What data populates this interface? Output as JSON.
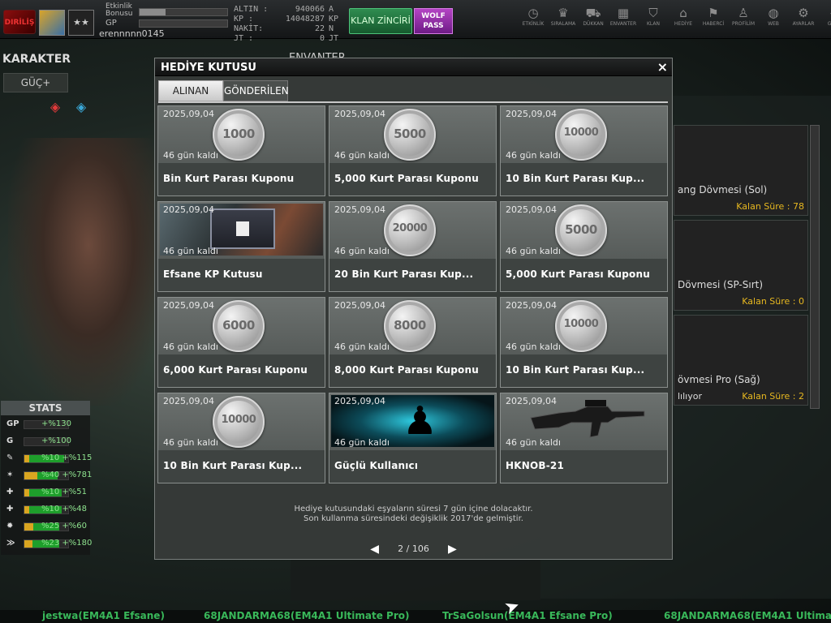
{
  "topbar": {
    "rank_badge": "DIRİLİŞ",
    "stars": "★★",
    "etkinlik_label": "Etkinlik Bonusu",
    "gp_label": "GP",
    "username": "erennnnn0145",
    "currency": [
      {
        "label": "ALTIN :",
        "value": "940066",
        "unit": "A"
      },
      {
        "label": "KP :",
        "value": "14048287",
        "unit": "KP"
      },
      {
        "label": "NAKİT:",
        "value": "22",
        "unit": "N"
      },
      {
        "label": "JT :",
        "value": "0",
        "unit": "JT"
      }
    ],
    "klan_button": "KLAN ZİNCİRİ",
    "wolf_button": "WOLF PASS",
    "nav": [
      {
        "label": "ETKİNLİK",
        "icon": "clock-icon",
        "glyph": "◷"
      },
      {
        "label": "SIRALAMA",
        "icon": "rank-icon",
        "glyph": "♛"
      },
      {
        "label": "DÜKKAN",
        "icon": "cart-icon",
        "glyph": "⛟"
      },
      {
        "label": "ENVANTER",
        "icon": "inventory-icon",
        "glyph": "▦"
      },
      {
        "label": "KLAN",
        "icon": "shield-icon",
        "glyph": "⛉"
      },
      {
        "label": "HEDİYE",
        "icon": "gift-icon",
        "glyph": "⌂"
      },
      {
        "label": "HABERCİ",
        "icon": "megaphone-icon",
        "glyph": "⚑"
      },
      {
        "label": "PROFİLİM",
        "icon": "profile-icon",
        "glyph": "♙"
      },
      {
        "label": "WEB",
        "icon": "globe-icon",
        "glyph": "◍"
      },
      {
        "label": "AYARLAR",
        "icon": "gear-icon",
        "glyph": "⚙"
      },
      {
        "label": "GERİ",
        "icon": "back-icon",
        "glyph": "«"
      }
    ]
  },
  "left": {
    "title": "KARAKTER",
    "guc_button": "GÜÇ+",
    "stats_title": "STATS",
    "stats": [
      {
        "icon": "GP",
        "value": "+%130",
        "green": 0.0,
        "yellow": 0.0
      },
      {
        "icon": "G",
        "value": "+%100",
        "green": 0.0,
        "yellow": 0.0
      },
      {
        "icon": "✎",
        "value": "%10 +%115",
        "green": 0.9,
        "yellow": 0.12
      },
      {
        "icon": "✶",
        "value": "%40 +%781",
        "green": 0.75,
        "yellow": 0.3
      },
      {
        "icon": "✚",
        "value": "%10 +%51",
        "green": 0.85,
        "yellow": 0.12
      },
      {
        "icon": "✚",
        "value": "%10 +%48",
        "green": 0.85,
        "yellow": 0.12
      },
      {
        "icon": "✹",
        "value": "%25 +%60",
        "green": 0.8,
        "yellow": 0.2
      },
      {
        "icon": "≫",
        "value": "%23 +%180",
        "green": 0.8,
        "yellow": 0.18
      }
    ]
  },
  "background": {
    "envanter_title": "ENVANTER",
    "inventory": [
      {
        "name": "ang Dövmesi (Sol)",
        "status": "Kalan Süre : 78"
      },
      {
        "name": "Dövmesi (SP-Sırt)",
        "status": "Kalan Süre : 0"
      },
      {
        "name": "övmesi Pro (Sağ)",
        "status": "Kalan Süre : 2",
        "sub": "lılıyor"
      }
    ]
  },
  "dialog": {
    "title": "HEDİYE KUTUSU",
    "close": "×",
    "tabs": [
      "ALINAN",
      "GÖNDERİLEN"
    ],
    "items": [
      {
        "date": "2025,09,04",
        "days": "46 gün kaldı",
        "name": "Bin Kurt Parası Kuponu",
        "type": "coin",
        "coin": "1000"
      },
      {
        "date": "2025,09,04",
        "days": "46 gün kaldı",
        "name": "5,000 Kurt Parası Kuponu",
        "type": "coin",
        "coin": "5000"
      },
      {
        "date": "2025,09,04",
        "days": "46 gün kaldı",
        "name": "10 Bin Kurt Parası Kup...",
        "type": "coin",
        "coin": "10000"
      },
      {
        "date": "2025,09,04",
        "days": "46 gün kaldı",
        "name": "Efsane KP Kutusu",
        "type": "box",
        "coin": ""
      },
      {
        "date": "2025,09,04",
        "days": "46 gün kaldı",
        "name": "20 Bin Kurt Parası Kup...",
        "type": "coin",
        "coin": "20000"
      },
      {
        "date": "2025,09,04",
        "days": "46 gün kaldı",
        "name": "5,000 Kurt Parası Kuponu",
        "type": "coin",
        "coin": "5000"
      },
      {
        "date": "2025,09,04",
        "days": "46 gün kaldı",
        "name": "6,000 Kurt Parası Kuponu",
        "type": "coin",
        "coin": "6000"
      },
      {
        "date": "2025,09,04",
        "days": "46 gün kaldı",
        "name": "8,000 Kurt Parası Kuponu",
        "type": "coin",
        "coin": "8000"
      },
      {
        "date": "2025,09,04",
        "days": "46 gün kaldı",
        "name": "10 Bin Kurt Parası Kup...",
        "type": "coin",
        "coin": "10000"
      },
      {
        "date": "2025,09,04",
        "days": "46 gün kaldı",
        "name": "10 Bin Kurt Parası Kup...",
        "type": "coin",
        "coin": "10000"
      },
      {
        "date": "2025,09,04",
        "days": "46 gün kaldı",
        "name": "Güçlü Kullanıcı",
        "type": "power",
        "coin": ""
      },
      {
        "date": "2025,09,04",
        "days": "46 gün kaldı",
        "name": "HKNOB-21",
        "type": "gun",
        "coin": ""
      }
    ],
    "notice_line1": "Hediye kutusundaki eşyaların süresi 7 gün içine dolacaktır.",
    "notice_line2": "Son kullanma süresindeki değişiklik 2017'de gelmiştir.",
    "page_text": "2 / 106"
  },
  "ticker": [
    "jestwa(EM4A1 Efsane)",
    "68JANDARMA68(EM4A1 Ultimate Pro)",
    "TrSaGolsun(EM4A1 Efsane Pro)",
    "68JANDARMA68(EM4A1 Ultimate Pro)"
  ]
}
